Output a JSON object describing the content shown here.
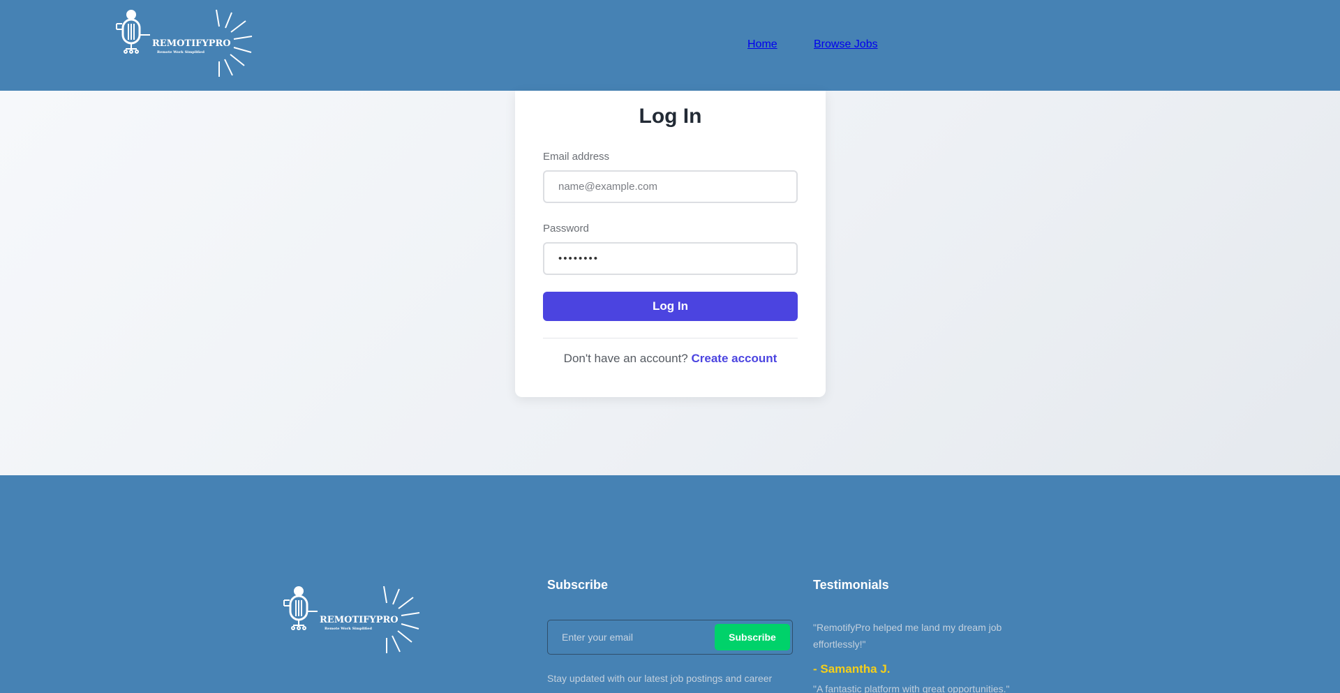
{
  "brand": {
    "name": "REMOTIFYPRO",
    "tagline": "Remote Work Simplified"
  },
  "nav": {
    "items": [
      {
        "label": "Home"
      },
      {
        "label": "Browse Jobs"
      }
    ]
  },
  "login": {
    "title": "Log In",
    "email_label": "Email address",
    "email_placeholder": "name@example.com",
    "password_label": "Password",
    "password_value": "••••••••",
    "submit_label": "Log In",
    "no_account_text": "Don't have an account?",
    "create_account_label": "Create account"
  },
  "footer": {
    "subscribe": {
      "heading": "Subscribe",
      "email_placeholder": "Enter your email",
      "button_label": "Subscribe",
      "description": "Stay updated with our latest job postings and career"
    },
    "testimonials": {
      "heading": "Testimonials",
      "items": [
        {
          "quote": "\"RemotifyPro helped me land my dream job effortlessly!\"",
          "author": "- Samantha J."
        },
        {
          "quote": "\"A fantastic platform with great opportunities.\""
        }
      ]
    }
  },
  "colors": {
    "header_bg": "#4682b4",
    "primary_button": "#4b44e0",
    "subscribe_button": "#00d26a",
    "author_accent": "#f5cf1a"
  }
}
